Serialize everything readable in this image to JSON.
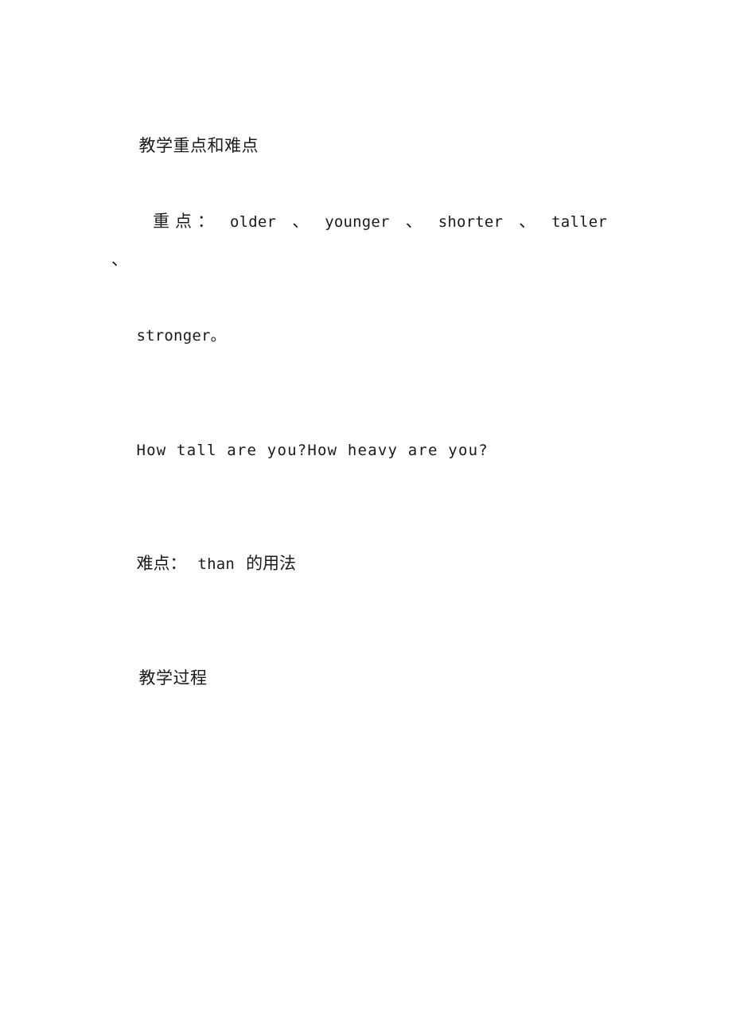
{
  "document": {
    "background_color": "#ffffff",
    "text_color": "#1a1a1a",
    "lines": {
      "heading_key_and_difficult_points": "教学重点和难点",
      "key_points_label": "重点",
      "key_points_colon": "：",
      "key_points_word_1": "older",
      "key_points_word_2": "younger",
      "key_points_word_3": "shorter",
      "key_points_word_4": "taller",
      "key_points_separator": "、",
      "key_points_continuation": "stronger。",
      "example_questions": "How tall are you?How heavy are you?",
      "difficulty_label": "难点：",
      "difficulty_word": "than",
      "difficulty_usage": "的用法",
      "heading_teaching_process": "教学过程"
    }
  }
}
